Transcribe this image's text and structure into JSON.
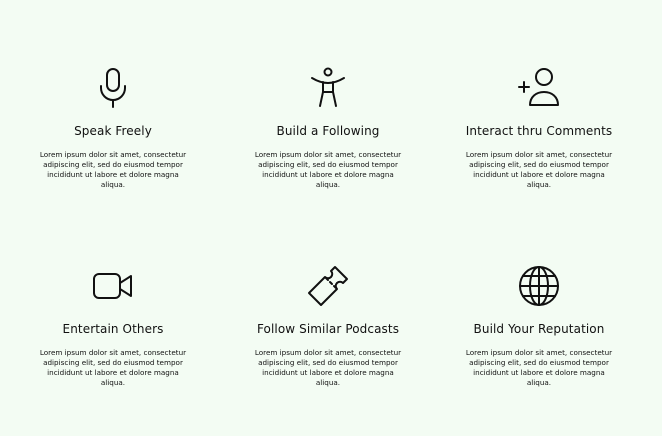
{
  "features": [
    {
      "icon": "microphone-icon",
      "title": "Speak Freely",
      "description": "Lorem ipsum dolor sit amet, consectetur adipiscing elit, sed do eiusmod tempor incididunt ut labore et dolore magna aliqua."
    },
    {
      "icon": "person-arms-raised-icon",
      "title": "Build a Following",
      "description": "Lorem ipsum dolor sit amet, consectetur adipiscing elit, sed do eiusmod tempor incididunt ut labore et dolore magna aliqua."
    },
    {
      "icon": "add-user-icon",
      "title": "Interact thru Comments",
      "description": "Lorem ipsum dolor sit amet, consectetur adipiscing elit, sed do eiusmod tempor incididunt ut labore et dolore magna aliqua."
    },
    {
      "icon": "video-camera-icon",
      "title": "Entertain Others",
      "description": "Lorem ipsum dolor sit amet, consectetur adipiscing elit, sed do eiusmod tempor incididunt ut labore et dolore magna aliqua."
    },
    {
      "icon": "ticket-icon",
      "title": "Follow Similar Podcasts",
      "description": "Lorem ipsum dolor sit amet, consectetur adipiscing elit, sed do eiusmod tempor incididunt ut labore et dolore magna aliqua."
    },
    {
      "icon": "globe-icon",
      "title": "Build Your Reputation",
      "description": "Lorem ipsum dolor sit amet, consectetur adipiscing elit, sed do eiusmod tempor incididunt ut labore et dolore magna aliqua."
    }
  ],
  "colors": {
    "background": "#f3fcf3",
    "text": "#111111"
  }
}
